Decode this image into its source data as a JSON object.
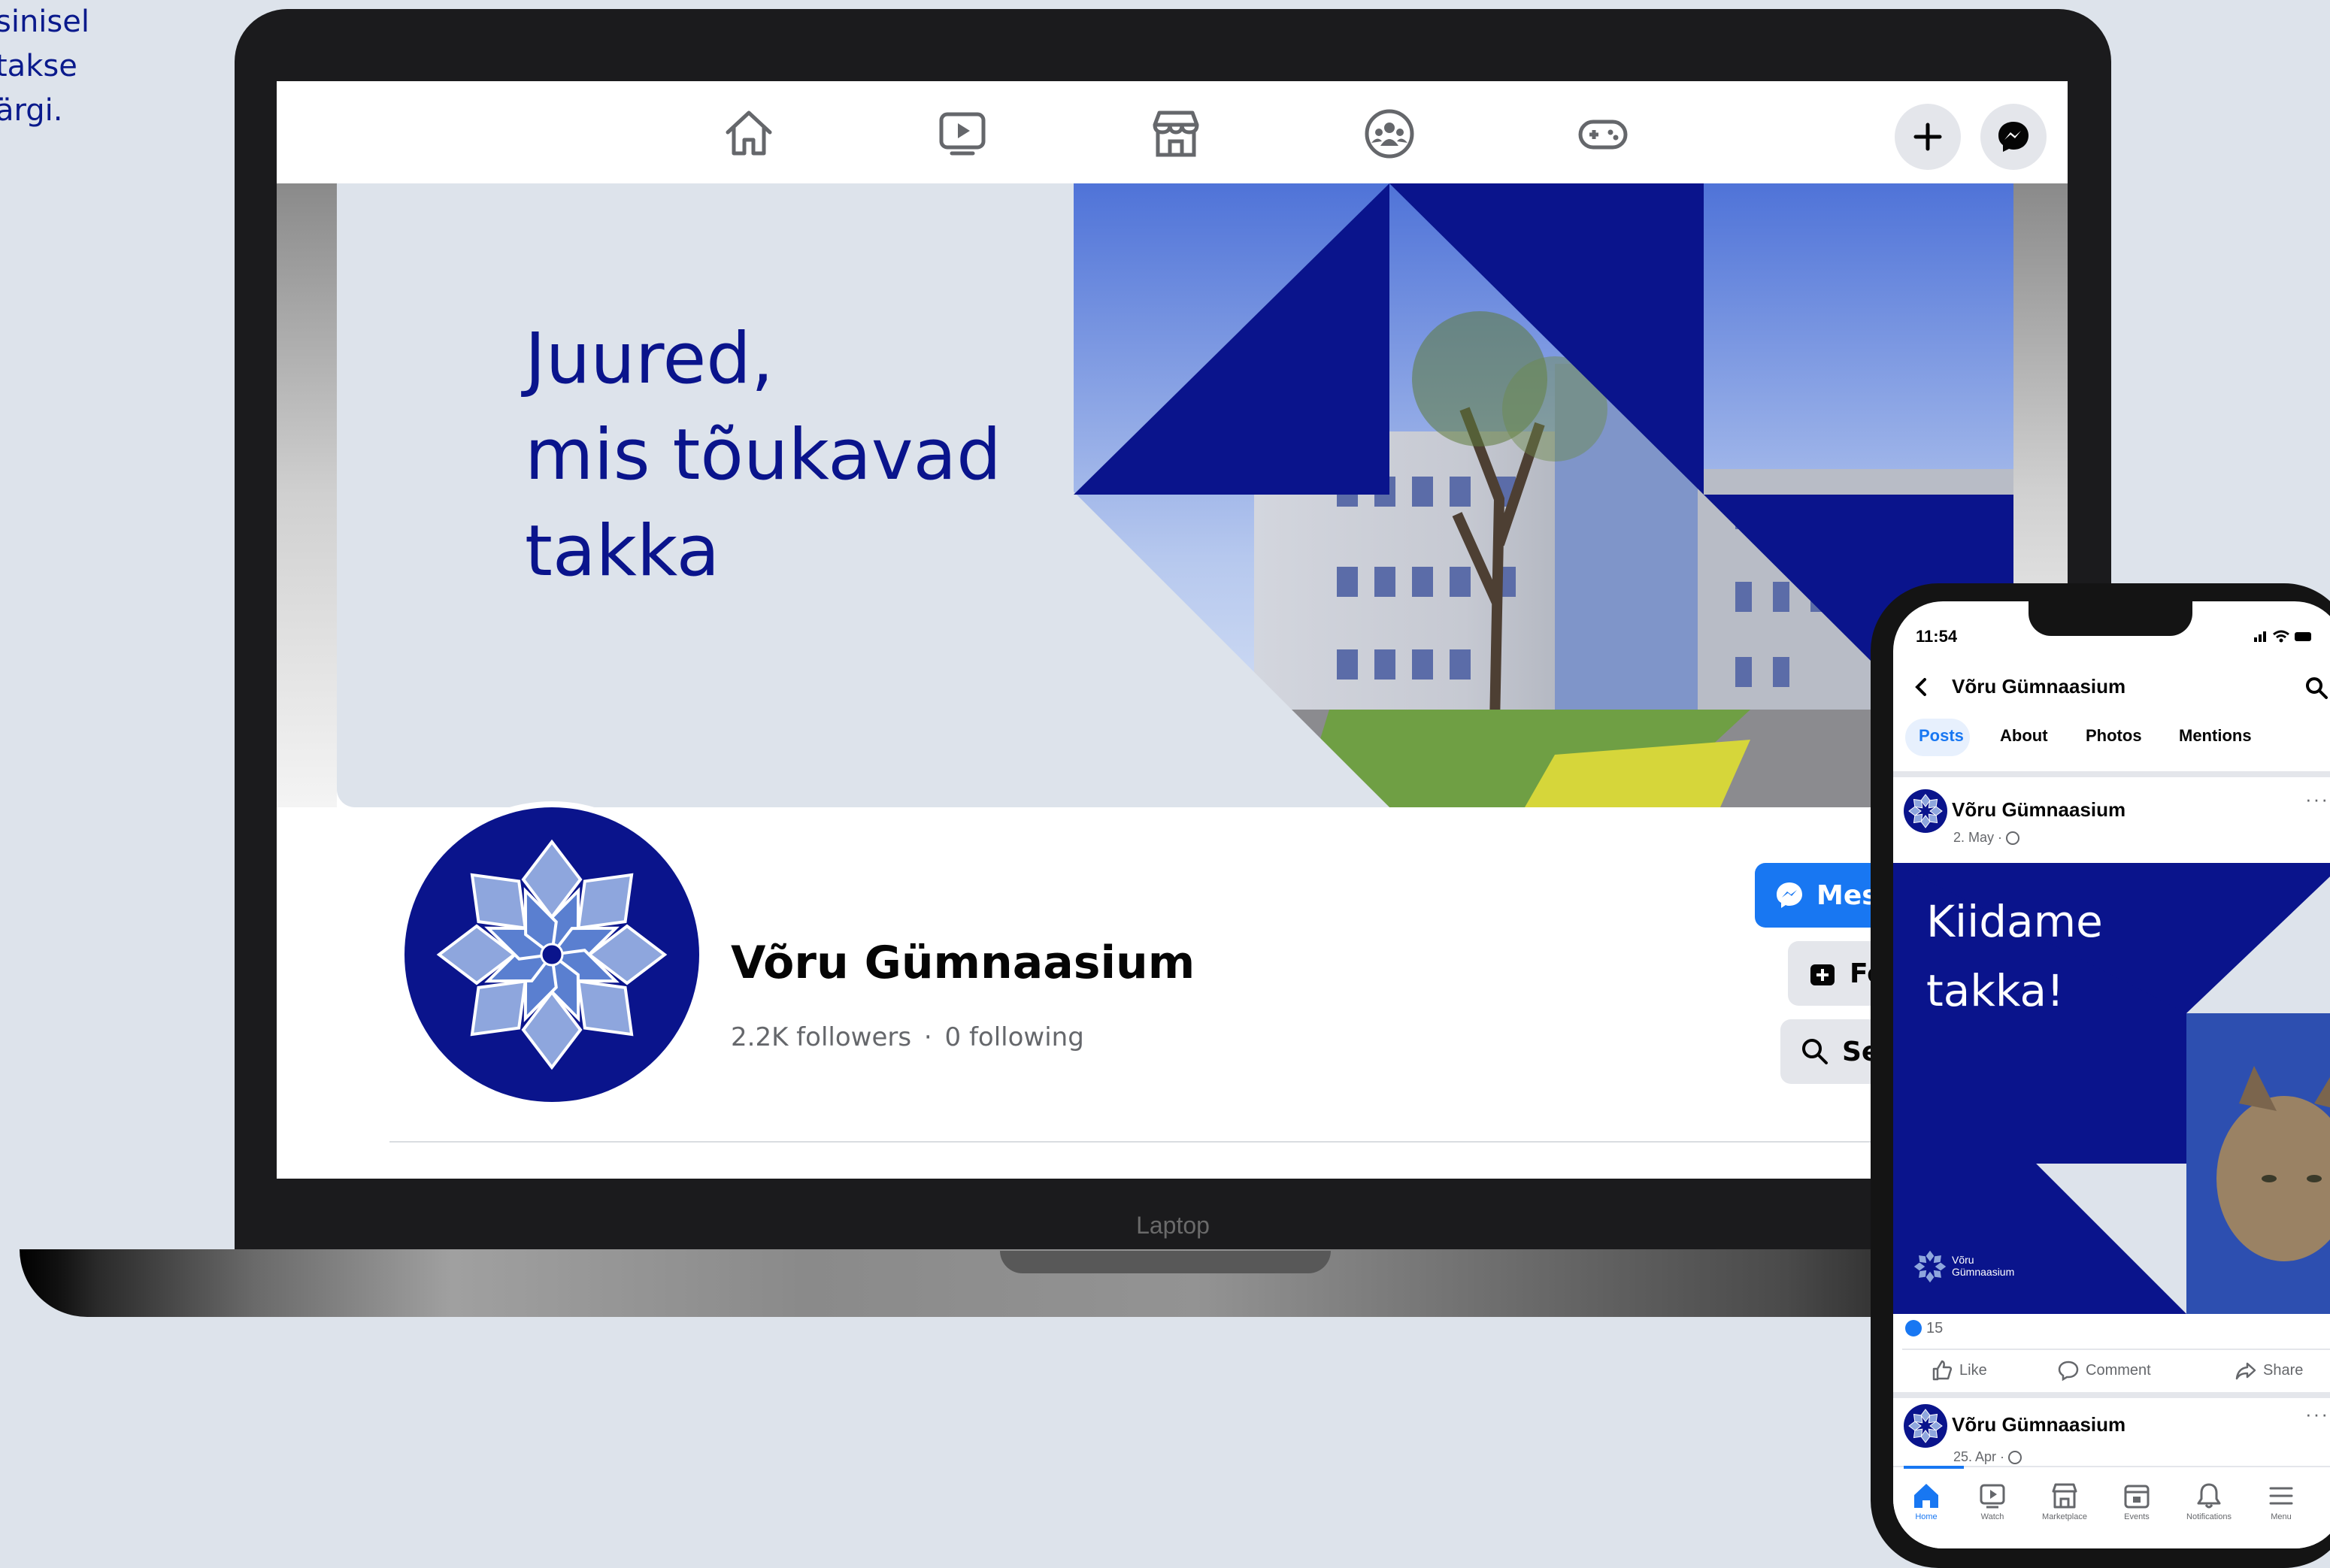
{
  "side_caption": [
    "sinisel",
    "takse",
    "ärgi."
  ],
  "laptop": {
    "label": "Laptop",
    "nav_icons": [
      "home-icon",
      "watch-icon",
      "marketplace-icon",
      "groups-icon",
      "gaming-icon"
    ],
    "cover": {
      "headline_lines": [
        "Juured,",
        "mis tõukavad",
        "takka"
      ]
    },
    "profile": {
      "name": "Võru Gümnaasium",
      "followers": "2.2K followers",
      "following": "0 following",
      "separator": "·"
    },
    "actions": {
      "message": "Mes",
      "follow": "Fo",
      "search": "Se"
    }
  },
  "phone": {
    "time": "11:54",
    "header_title": "Võru Gümnaasium",
    "tabs": [
      "Posts",
      "About",
      "Photos",
      "Mentions"
    ],
    "active_tab": "Posts",
    "post1": {
      "author": "Võru Gümnaasium",
      "date": "2. May ·",
      "image_text_lines": [
        "Kiidame",
        "takka!"
      ],
      "logo_text_lines": [
        "Võru",
        "Gümnaasium"
      ],
      "reactions_count": "15",
      "actions": [
        "Like",
        "Comment",
        "Share"
      ]
    },
    "post2": {
      "author": "Võru Gümnaasium",
      "date": "25. Apr ·"
    },
    "bottom_nav": [
      "Home",
      "Watch",
      "Marketplace",
      "Events",
      "Notifications",
      "Menu"
    ],
    "colors": {
      "brand_navy": "#0a148c",
      "fb_blue": "#1877f2"
    }
  }
}
